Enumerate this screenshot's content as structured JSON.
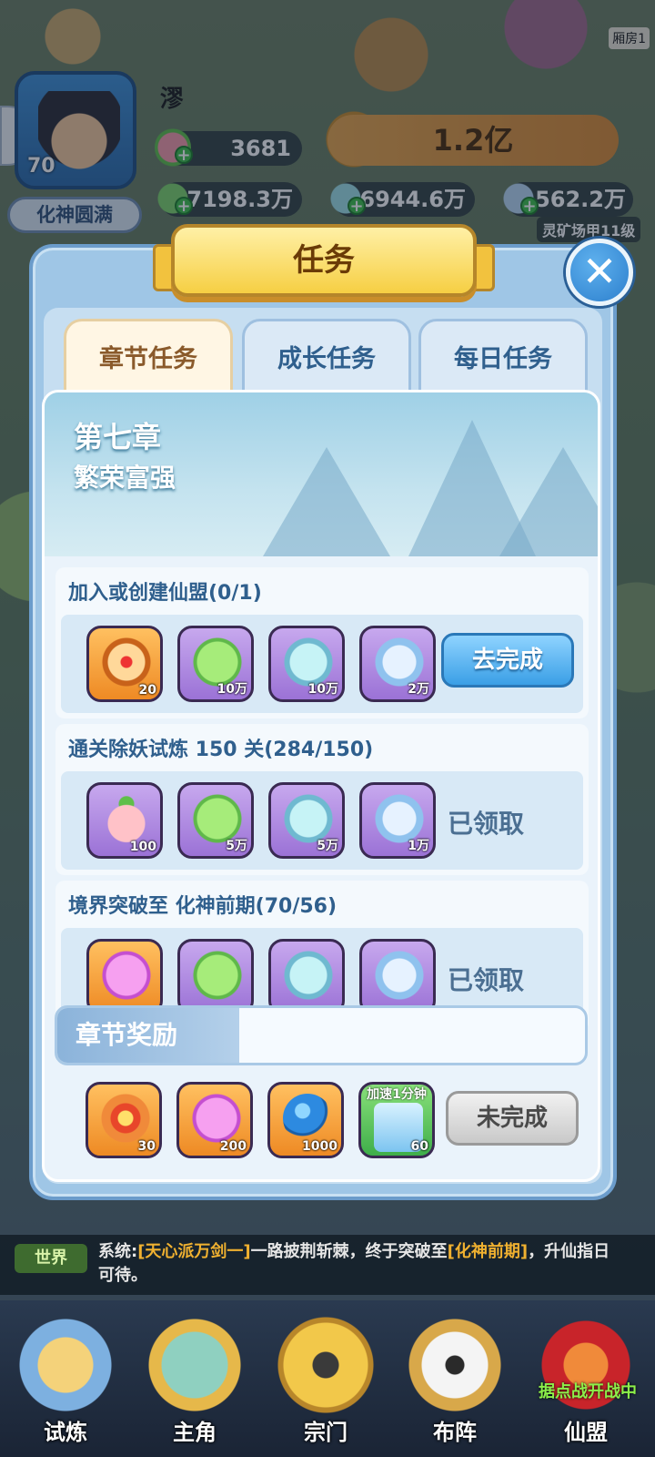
{
  "hud": {
    "player_name": "漻",
    "level": "70",
    "realm": "化神圆满",
    "peach_count": "3681",
    "power": "1.2亿",
    "res1": "7198.3万",
    "res2": "6944.6万",
    "res3": "1562.2万",
    "mine_label": "灵矿场甲11级",
    "corner_tag": "厢房1"
  },
  "dialog": {
    "title": "任务",
    "close": "✕",
    "tabs": [
      {
        "label": "章节任务"
      },
      {
        "label": "成长任务"
      },
      {
        "label": "每日任务"
      }
    ],
    "chapter": {
      "number": "第七章",
      "name": "繁荣富强"
    },
    "tasks": [
      {
        "title": "加入或创建仙盟(0/1)",
        "rewards": [
          {
            "icon": "token-icon",
            "qty": "20"
          },
          {
            "icon": "wood-icon",
            "qty": "10万"
          },
          {
            "icon": "ore-icon",
            "qty": "10万"
          },
          {
            "icon": "crystal-icon",
            "qty": "2万"
          }
        ],
        "action": "去完成"
      },
      {
        "title": "通关除妖试炼 150 关(284/150)",
        "rewards": [
          {
            "icon": "peach-icon",
            "qty": "100"
          },
          {
            "icon": "wood-icon",
            "qty": "5万"
          },
          {
            "icon": "ore-icon",
            "qty": "5万"
          },
          {
            "icon": "crystal-icon",
            "qty": "1万"
          }
        ],
        "status": "已领取"
      },
      {
        "title": "境界突破至 化神前期(70/56)",
        "rewards": [
          {
            "icon": "spirit-flame-icon",
            "qty": ""
          },
          {
            "icon": "wood-icon",
            "qty": ""
          },
          {
            "icon": "ore-icon",
            "qty": ""
          },
          {
            "icon": "crystal-icon",
            "qty": ""
          }
        ],
        "status": "已领取"
      }
    ],
    "chapter_reward": {
      "label": "章节奖励",
      "items": [
        {
          "icon": "fire-scroll-icon",
          "qty": "30"
        },
        {
          "icon": "spirit-flame-icon",
          "qty": "200"
        },
        {
          "icon": "blue-orb-icon",
          "qty": "1000"
        },
        {
          "icon": "speedup-ticket-icon",
          "qty": "60",
          "tag": "加速1分钟"
        }
      ],
      "action": "未完成"
    }
  },
  "chat": {
    "channel": "世界",
    "msg_prefix": "系统:",
    "msg_name": "[天心派万剑一]",
    "msg_mid": "一路披荆斩棘，终于突破至",
    "msg_realm": "[化神前期]",
    "msg_end": "，升仙指日可待。"
  },
  "nav": {
    "items": [
      {
        "label": "试炼"
      },
      {
        "label": "主角"
      },
      {
        "label": "宗门"
      },
      {
        "label": "布阵"
      },
      {
        "label": "仙盟"
      }
    ],
    "alert": "据点战开战中"
  }
}
